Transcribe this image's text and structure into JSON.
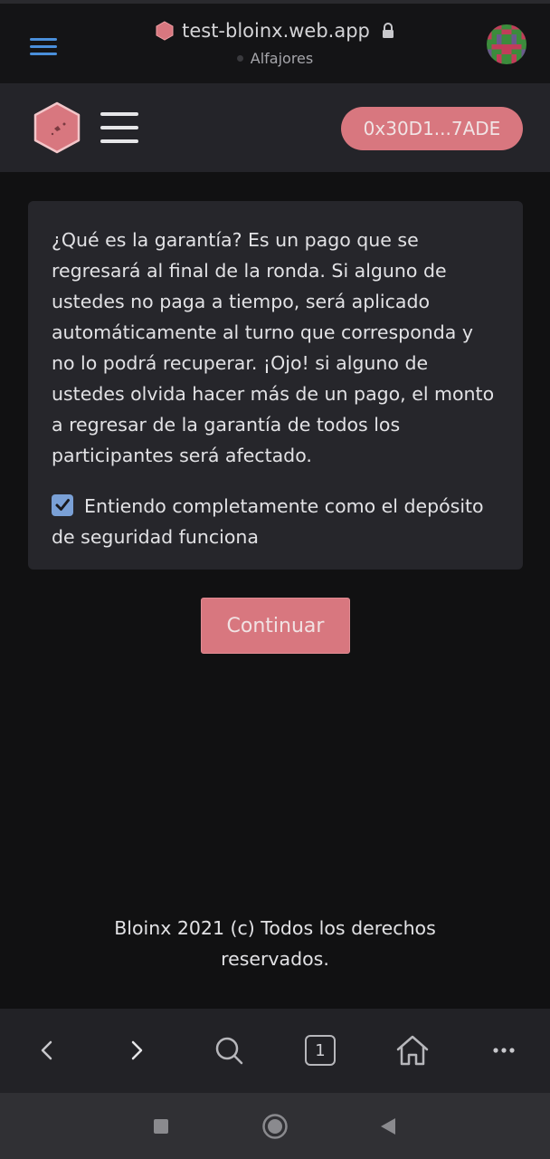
{
  "browser": {
    "url": "test-bloinx.web.app",
    "network": "Alfajores",
    "avatar_icon": "identicon-avatar"
  },
  "header": {
    "wallet_address": "0x30D1...7ADE",
    "logo_icon": "bloinx-hexagon-logo",
    "accent_color": "#d8777f"
  },
  "card": {
    "paragraph": "¿Qué es la garantía? Es un pago que se regresará al final de la ronda. Si alguno de ustedes no paga a tiempo, será aplicado automáticamente al turno que corresponda y no lo podrá recuperar. ¡Ojo! si alguno de ustedes olvida hacer más de un pago, el monto a regresar de la garantía de todos los participantes será afectado.",
    "checkbox_label": "Entiendo completamente como el depósito de seguridad funciona",
    "checkbox_checked": true
  },
  "actions": {
    "continue_label": "Continuar"
  },
  "footer": {
    "line1": "Bloinx 2021 (c) Todos los derechos",
    "line2": "reservados."
  },
  "browser_nav": {
    "tab_count": "1",
    "icons": [
      "back-icon",
      "forward-icon",
      "search-icon",
      "tabs-icon",
      "home-icon",
      "more-icon"
    ]
  },
  "android_nav": {
    "icons": [
      "recents-icon",
      "home-circle-icon",
      "back-triangle-icon"
    ]
  }
}
